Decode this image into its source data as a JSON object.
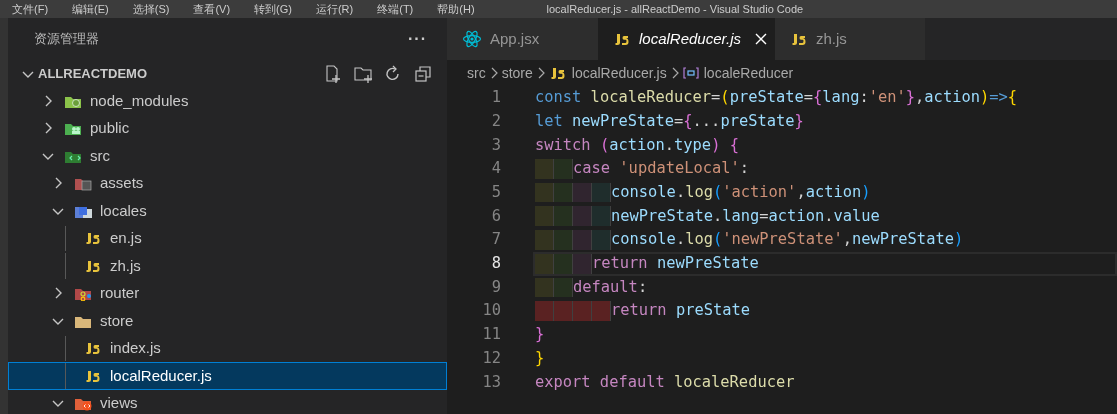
{
  "menu_bar": {
    "items": [
      "文件(F)",
      "编辑(E)",
      "选择(S)",
      "查看(V)",
      "转到(G)",
      "运行(R)",
      "终端(T)",
      "帮助(H)"
    ],
    "title": "localReducer.js - allReactDemo - Visual Studio Code"
  },
  "sidebar": {
    "title": "资源管理器",
    "more": "···",
    "project": {
      "name": "ALLREACTDEMO",
      "expanded": true
    },
    "items": [
      {
        "label": "node_modules",
        "kind": "folder",
        "expanded": false,
        "selected": false
      },
      {
        "label": "public",
        "kind": "folder",
        "expanded": false,
        "selected": false
      },
      {
        "label": "src",
        "kind": "folder",
        "expanded": true,
        "selected": false,
        "children": [
          {
            "label": "assets",
            "kind": "folder",
            "expanded": false,
            "selected": false
          },
          {
            "label": "locales",
            "kind": "folder",
            "expanded": true,
            "selected": false,
            "children": [
              {
                "label": "en.js",
                "kind": "file",
                "selected": false
              },
              {
                "label": "zh.js",
                "kind": "file",
                "selected": false
              }
            ]
          },
          {
            "label": "router",
            "kind": "folder",
            "expanded": false,
            "selected": false
          },
          {
            "label": "store",
            "kind": "folder",
            "expanded": true,
            "selected": false,
            "children": [
              {
                "label": "index.js",
                "kind": "file",
                "selected": false
              },
              {
                "label": "localReducer.js",
                "kind": "file",
                "selected": true
              }
            ]
          },
          {
            "label": "views",
            "kind": "folder",
            "expanded": true,
            "selected": false
          }
        ]
      }
    ]
  },
  "tabs": [
    {
      "label": "App.jsx",
      "kind": "react",
      "selected": false,
      "preview": false
    },
    {
      "label": "localReducer.js",
      "kind": "js",
      "selected": true,
      "preview": true
    },
    {
      "label": "zh.js",
      "kind": "js",
      "selected": false,
      "preview": false
    }
  ],
  "breadcrumb": [
    {
      "label": "src",
      "kind": "folder"
    },
    {
      "label": "store",
      "kind": "folder"
    },
    {
      "label": "localReducer.js",
      "kind": "js"
    },
    {
      "label": "localeReducer",
      "kind": "symbol"
    }
  ],
  "code": [
    {
      "number": "1",
      "current": false,
      "tokens": [
        {
          "text": "const ",
          "kind": "keyword"
        },
        {
          "text": "localeReducer",
          "kind": "function"
        },
        {
          "text": "=",
          "kind": "operator"
        },
        {
          "text": "(",
          "kind": "bracket1"
        },
        {
          "text": "preState",
          "kind": "variable"
        },
        {
          "text": "=",
          "kind": "operator"
        },
        {
          "text": "{",
          "kind": "bracket2"
        },
        {
          "text": "lang",
          "kind": "variable"
        },
        {
          "text": ":",
          "kind": "operator"
        },
        {
          "text": "'en'",
          "kind": "string"
        },
        {
          "text": "}",
          "kind": "bracket2"
        },
        {
          "text": ",",
          "kind": "operator"
        },
        {
          "text": "action",
          "kind": "variable"
        },
        {
          "text": ")",
          "kind": "bracket1"
        },
        {
          "text": "=>",
          "kind": "keyword"
        },
        {
          "text": "{",
          "kind": "bracket1"
        }
      ]
    },
    {
      "number": "2",
      "current": false,
      "tokens": [
        {
          "text": "let ",
          "kind": "keyword"
        },
        {
          "text": "newPreState",
          "kind": "variable"
        },
        {
          "text": "=",
          "kind": "operator"
        },
        {
          "text": "{",
          "kind": "bracket2"
        },
        {
          "text": "...",
          "kind": "operator"
        },
        {
          "text": "preState",
          "kind": "variable"
        },
        {
          "text": "}",
          "kind": "bracket2"
        }
      ]
    },
    {
      "number": "3",
      "current": false,
      "tokens": [
        {
          "text": "switch ",
          "kind": "control"
        },
        {
          "text": "(",
          "kind": "bracket2"
        },
        {
          "text": "action",
          "kind": "variable"
        },
        {
          "text": ".",
          "kind": "operator"
        },
        {
          "text": "type",
          "kind": "variable"
        },
        {
          "text": ") {",
          "kind": "bracket2"
        }
      ]
    },
    {
      "number": "4",
      "current": false,
      "guides": [
        {
          "color": "#33331f"
        },
        {
          "color": "#25301f"
        }
      ],
      "tokens": [
        {
          "text": "case ",
          "kind": "control"
        },
        {
          "text": "'updateLocal'",
          "kind": "string"
        },
        {
          "text": ":",
          "kind": "operator"
        }
      ]
    },
    {
      "number": "5",
      "current": false,
      "guides": [
        {
          "color": "#33331f"
        },
        {
          "color": "#25301f"
        },
        {
          "color": "#30252f"
        },
        {
          "color": "#1f2d2c"
        }
      ],
      "tokens": [
        {
          "text": "console",
          "kind": "variable"
        },
        {
          "text": ".",
          "kind": "operator"
        },
        {
          "text": "log",
          "kind": "function"
        },
        {
          "text": "(",
          "kind": "bracket3"
        },
        {
          "text": "'action'",
          "kind": "string"
        },
        {
          "text": ",",
          "kind": "operator"
        },
        {
          "text": "action",
          "kind": "variable"
        },
        {
          "text": ")",
          "kind": "bracket3"
        }
      ]
    },
    {
      "number": "6",
      "current": false,
      "guides": [
        {
          "color": "#33331f"
        },
        {
          "color": "#25301f"
        },
        {
          "color": "#30252f"
        },
        {
          "color": "#1f2d2c"
        }
      ],
      "tokens": [
        {
          "text": "newPreState",
          "kind": "variable"
        },
        {
          "text": ".",
          "kind": "operator"
        },
        {
          "text": "lang",
          "kind": "variable"
        },
        {
          "text": "=",
          "kind": "operator"
        },
        {
          "text": "action",
          "kind": "variable"
        },
        {
          "text": ".",
          "kind": "operator"
        },
        {
          "text": "value",
          "kind": "variable"
        }
      ]
    },
    {
      "number": "7",
      "current": false,
      "guides": [
        {
          "color": "#33331f"
        },
        {
          "color": "#25301f"
        },
        {
          "color": "#30252f"
        },
        {
          "color": "#1f2d2c"
        }
      ],
      "tokens": [
        {
          "text": "console",
          "kind": "variable"
        },
        {
          "text": ".",
          "kind": "operator"
        },
        {
          "text": "log",
          "kind": "function"
        },
        {
          "text": "(",
          "kind": "bracket3"
        },
        {
          "text": "'newPreState'",
          "kind": "string"
        },
        {
          "text": ",",
          "kind": "operator"
        },
        {
          "text": "newPreState",
          "kind": "variable"
        },
        {
          "text": ")",
          "kind": "bracket3"
        }
      ]
    },
    {
      "number": "8",
      "current": true,
      "guides": [
        {
          "color": "#33331f"
        },
        {
          "color": "#25301f"
        },
        {
          "color": "#30252f"
        }
      ],
      "tokens": [
        {
          "text": "return ",
          "kind": "control"
        },
        {
          "text": "newPreState",
          "kind": "variable"
        }
      ]
    },
    {
      "number": "9",
      "current": false,
      "guides": [
        {
          "color": "#33331f"
        },
        {
          "color": "#25301f"
        }
      ],
      "tokens": [
        {
          "text": "default",
          "kind": "control"
        },
        {
          "text": ":",
          "kind": "operator"
        }
      ]
    },
    {
      "number": "10",
      "current": false,
      "guides": [
        {
          "color": "#5a2222"
        },
        {
          "color": "#5a2222"
        },
        {
          "color": "#5a2222"
        },
        {
          "color": "#5a2222"
        }
      ],
      "tokens": [
        {
          "text": "return ",
          "kind": "control"
        },
        {
          "text": "preState",
          "kind": "variable"
        }
      ]
    },
    {
      "number": "11",
      "current": false,
      "tokens": [
        {
          "text": "}",
          "kind": "bracket2"
        }
      ]
    },
    {
      "number": "12",
      "current": false,
      "tokens": [
        {
          "text": "}",
          "kind": "bracket1"
        }
      ]
    },
    {
      "number": "13",
      "current": false,
      "tokens": [
        {
          "text": "export default ",
          "kind": "control"
        },
        {
          "text": "localeReducer",
          "kind": "function"
        }
      ]
    }
  ]
}
